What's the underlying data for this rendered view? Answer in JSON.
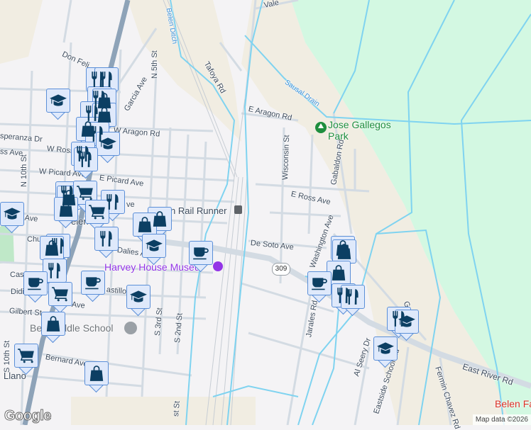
{
  "map": {
    "colors": {
      "park": "#d3f8e2",
      "land_tan": "#f1ede2",
      "water": "#7fd3f0",
      "road": "#d3dbe3",
      "highway": "#8ea3b8",
      "marker_bg": "#dfe9fb",
      "marker_icon": "#0c3f63",
      "poi_purple": "#9334e6",
      "poi_green": "#1e8e3e",
      "poi_red": "#d93025"
    },
    "streets": {
      "valencia": "Vale",
      "tafoya": "Tafoya Rd",
      "belen_ditch": "Belen Ditch",
      "don_felipe": "Don Feli",
      "garcia": "Garcia Ave",
      "n5th": "N 5th St",
      "esperanza": "speranza Dr",
      "w_aragon": "W Aragon Rd",
      "e_aragon": "E Aragon Rd",
      "sausal": "Sausal Drain",
      "w_ross": "W Ross",
      "ross_ave": "ss Ave",
      "n10th": "N 10th St",
      "w_picard": "W Picard Ave",
      "e_picard": "E Picard Ave",
      "reinken": "einken Ave",
      "wisconsin": "Wisconsin St",
      "gabaldon": "Gabaldon Rd",
      "e_ross": "E Ross Ave",
      "washington": "Washington Ave",
      "de_soto": "De Soto Ave",
      "dalies": "Dalies Av",
      "chu": "Chu",
      "cas": "Cas",
      "castillo": "astillo",
      "didi": "Didi",
      "gilbert": "Gilbert St",
      "s3rd": "S 3rd St",
      "s2nd": "S 2nd St",
      "jarales": "Jarales Rd",
      "bernard": "Bernard Ave",
      "s10th": "S 10th St",
      "llano": "Llano",
      "east_river": "East River Rd",
      "al_seery": "Al Seery Dr",
      "eastside_school": "Eastside School Rd",
      "fermin": "Fermin Chavez Rd",
      "gab2": "Gab",
      "st1": "st St",
      "ave": "Ave",
      "ave2": "ve",
      "hwy": "309"
    },
    "pois": {
      "park": "Jose Gallegos Park",
      "rail": "n Rail Runner",
      "museum": "Harvey House Museu",
      "school": "Be       ddle School",
      "belen_red": "Belen Fa",
      "belen_town": "elen"
    },
    "icons": [
      "restaurant-icon",
      "shopping-bag-icon",
      "shopping-cart-icon",
      "cafe-icon",
      "school-icon"
    ],
    "logo": "Google",
    "attribution": "Map data ©2026"
  }
}
